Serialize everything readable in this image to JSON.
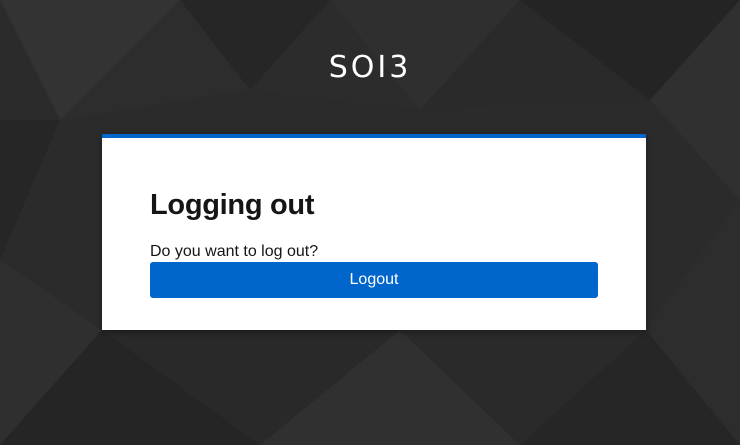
{
  "brand": {
    "name": "SOI3"
  },
  "dialog": {
    "title": "Logging out",
    "message": "Do you want to log out?",
    "logout_label": "Logout"
  },
  "colors": {
    "accent": "#0066cc",
    "background": "#2a2a2a",
    "card": "#ffffff",
    "text": "#151515"
  }
}
